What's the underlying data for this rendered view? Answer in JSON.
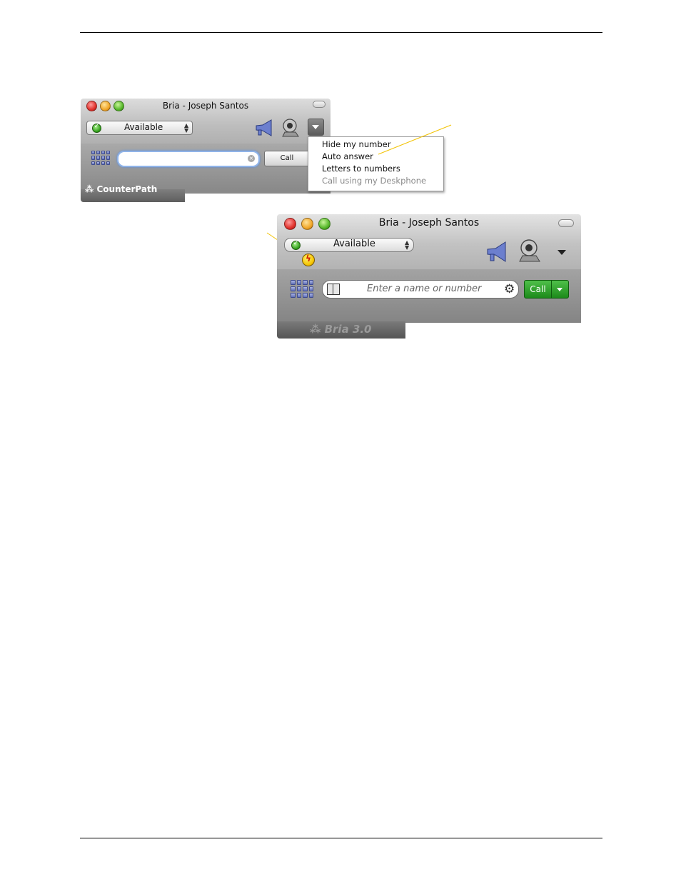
{
  "window1": {
    "title": "Bria - Joseph Santos",
    "presence": "Available",
    "call_label": "Call",
    "brand": "CounterPath",
    "menu_items": [
      {
        "label": "Hide my number",
        "enabled": true
      },
      {
        "label": "Auto answer",
        "enabled": true
      },
      {
        "label": "Letters to numbers",
        "enabled": true
      },
      {
        "label": "Call using my Deskphone",
        "enabled": false
      }
    ]
  },
  "window2": {
    "title": "Bria - Joseph Santos",
    "presence": "Available",
    "search_placeholder": "Enter a name or number",
    "call_label": "Call",
    "brand": "Bria 3.0"
  },
  "colors": {
    "callout_line": "#f2c200",
    "call_green": "#2aa024",
    "search_focus": "#8fb3e8"
  },
  "icons": [
    "keypad-icon",
    "megaphone-icon",
    "webcam-icon",
    "contacts-book-icon",
    "gear-icon",
    "auto-answer-bolt-icon",
    "dropdown-arrow-icon"
  ]
}
